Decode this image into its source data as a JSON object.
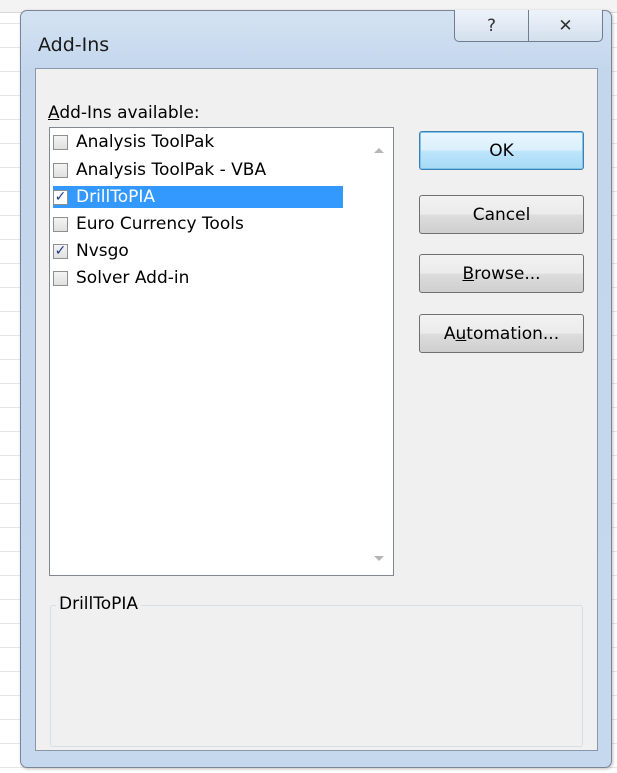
{
  "dialog": {
    "title": "Add-Ins",
    "help_glyph": "?",
    "close_glyph": "✕"
  },
  "list": {
    "label_prefix": "A",
    "label_rest": "dd-Ins available:",
    "items": [
      {
        "label": "Analysis ToolPak",
        "checked": false,
        "selected": false
      },
      {
        "label": "Analysis ToolPak - VBA",
        "checked": false,
        "selected": false
      },
      {
        "label": "DrillToPIA",
        "checked": true,
        "selected": true
      },
      {
        "label": "Euro Currency Tools",
        "checked": false,
        "selected": false
      },
      {
        "label": "Nvsgo",
        "checked": true,
        "selected": false
      },
      {
        "label": "Solver Add-in",
        "checked": false,
        "selected": false
      }
    ]
  },
  "buttons": {
    "ok": "OK",
    "cancel": "Cancel",
    "browse_pre": "B",
    "browse_rest": "rowse...",
    "automation_pre": "A",
    "automation_u": "u",
    "automation_rest": "tomation..."
  },
  "details": {
    "title": "DrillToPIA"
  },
  "colors": {
    "selection": "#3399ff",
    "dialog_frame": "#c3d6ec"
  },
  "icons": [
    "help-icon",
    "close-icon",
    "checkbox-icon",
    "scroll-up-icon",
    "scroll-down-icon"
  ]
}
